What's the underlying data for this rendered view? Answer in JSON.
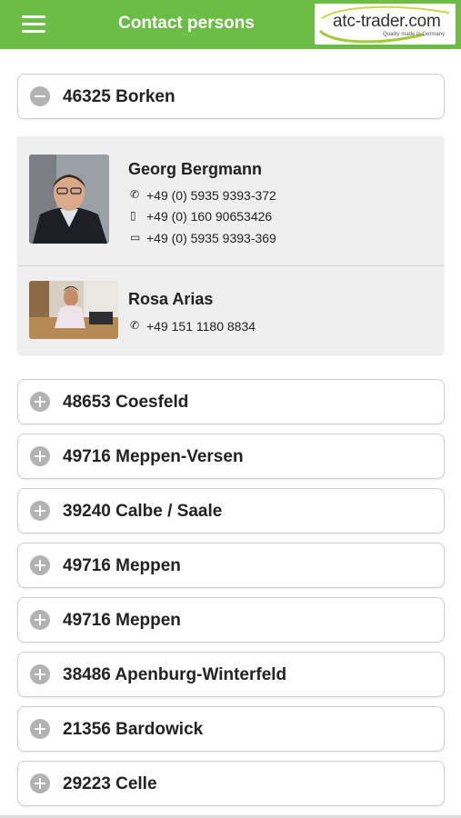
{
  "header": {
    "title": "Contact persons",
    "logo_text": "atc-trader.com",
    "logo_tagline": "Quality made in Germany",
    "brand_color": "#6cbd45"
  },
  "expanded_location": "46325 Borken",
  "contacts": [
    {
      "name": "Georg Bergmann",
      "phone": "+49 (0) 5935 9393-372",
      "mobile": "+49 (0) 160 90653426",
      "fax": "+49 (0) 5935 9393-369"
    },
    {
      "name": "Rosa Arias",
      "phone": "+49 151 1180 8834"
    }
  ],
  "locations": [
    "48653 Coesfeld",
    "49716 Meppen-Versen",
    "39240 Calbe / Saale",
    "49716 Meppen",
    "49716 Meppen",
    "38486 Apenburg-Winterfeld",
    "21356 Bardowick",
    "29223 Celle"
  ],
  "icons": {
    "menu": "hamburger-icon",
    "collapse": "minus-circle-icon",
    "expand": "plus-circle-icon",
    "phone": "phone-icon",
    "mobile": "mobile-icon",
    "fax": "fax-icon"
  }
}
